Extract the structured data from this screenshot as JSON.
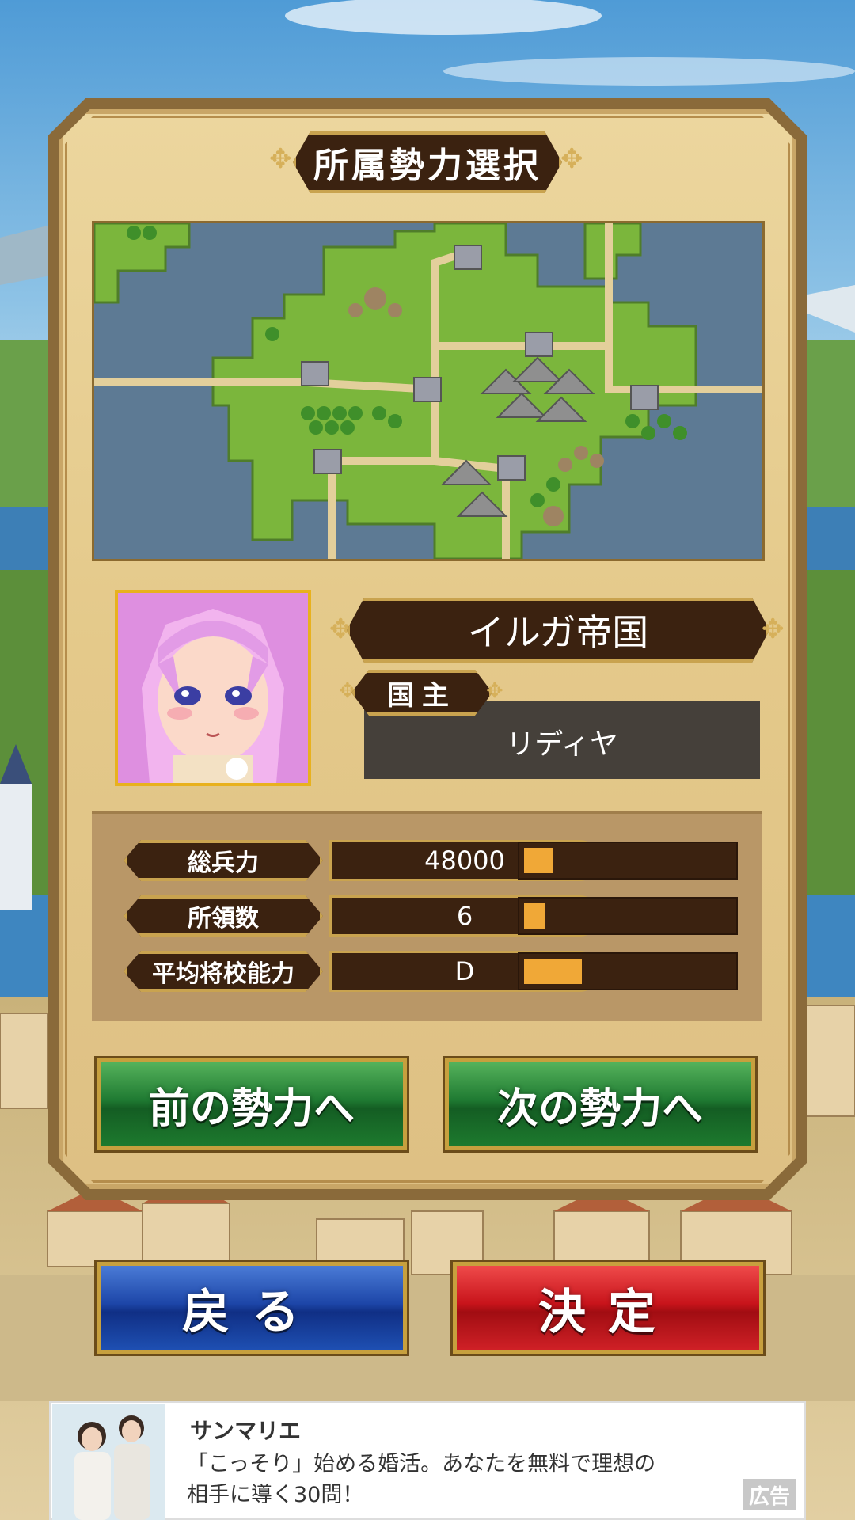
{
  "title": "所属勢力選択",
  "faction": {
    "name": "イルガ帝国",
    "ruler_label": "国主",
    "ruler_name": "リディヤ"
  },
  "stats": [
    {
      "label": "総兵力",
      "value": "48000",
      "bar_fraction": 0.14
    },
    {
      "label": "所領数",
      "value": "6",
      "bar_fraction": 0.1
    },
    {
      "label": "平均将校能力",
      "value": "D",
      "bar_fraction": 0.28
    }
  ],
  "buttons": {
    "prev": "前の勢力へ",
    "next": "次の勢力へ",
    "back": "戻る",
    "confirm": "決定"
  },
  "ad": {
    "title": "サンマリエ",
    "text_line1": "「こっそり」始める婚活。あなたを無料で理想の",
    "text_line2": "相手に導く30問！",
    "badge": "広告"
  },
  "colors": {
    "banner": "#3b2210",
    "gold": "#c9a34f",
    "bar_fill": "#f0a837",
    "green_button": "#1f7a32",
    "blue_button": "#1d46a8",
    "red_button": "#c8141b"
  }
}
